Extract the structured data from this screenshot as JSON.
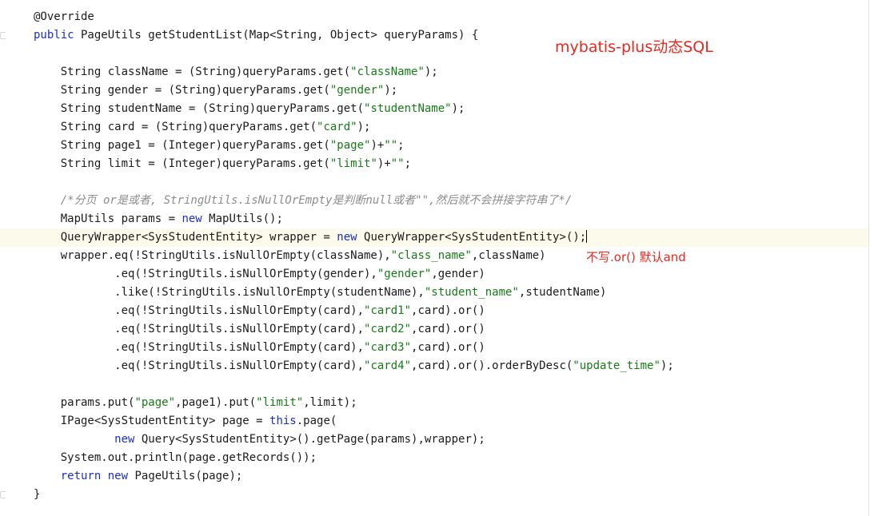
{
  "editor": {
    "lines": [
      [
        {
          "t": "@Override",
          "c": "plain"
        }
      ],
      [
        {
          "t": "public",
          "c": "kw"
        },
        {
          "t": " PageUtils getStudentList(Map<String, Object> queryParams) {",
          "c": "plain"
        }
      ],
      [],
      [
        {
          "t": "    String className = (String)queryParams.get(",
          "c": "plain"
        },
        {
          "t": "\"className\"",
          "c": "str"
        },
        {
          "t": ");",
          "c": "plain"
        }
      ],
      [
        {
          "t": "    String gender = (String)queryParams.get(",
          "c": "plain"
        },
        {
          "t": "\"gender\"",
          "c": "str"
        },
        {
          "t": ");",
          "c": "plain"
        }
      ],
      [
        {
          "t": "    String studentName = (String)queryParams.get(",
          "c": "plain"
        },
        {
          "t": "\"studentName\"",
          "c": "str"
        },
        {
          "t": ");",
          "c": "plain"
        }
      ],
      [
        {
          "t": "    String card = (String)queryParams.get(",
          "c": "plain"
        },
        {
          "t": "\"card\"",
          "c": "str"
        },
        {
          "t": ");",
          "c": "plain"
        }
      ],
      [
        {
          "t": "    String page1 = (Integer)queryParams.get(",
          "c": "plain"
        },
        {
          "t": "\"page\"",
          "c": "str"
        },
        {
          "t": ")+",
          "c": "plain"
        },
        {
          "t": "\"\"",
          "c": "str"
        },
        {
          "t": ";",
          "c": "plain"
        }
      ],
      [
        {
          "t": "    String limit = (Integer)queryParams.get(",
          "c": "plain"
        },
        {
          "t": "\"limit\"",
          "c": "str"
        },
        {
          "t": ")+",
          "c": "plain"
        },
        {
          "t": "\"\"",
          "c": "str"
        },
        {
          "t": ";",
          "c": "plain"
        }
      ],
      [],
      [
        {
          "t": "    /*分页 or是或者, StringUtils.isNullOrEmpty是判断null或者\"\",然后就不会拼接字符串了*/",
          "c": "cmt"
        }
      ],
      [
        {
          "t": "    MapUtils params = ",
          "c": "plain"
        },
        {
          "t": "new",
          "c": "kw"
        },
        {
          "t": " MapUtils();",
          "c": "plain"
        }
      ],
      [
        {
          "t": "    QueryWrapper<SysStudentEntity> wrapper = ",
          "c": "plain"
        },
        {
          "t": "new",
          "c": "kw"
        },
        {
          "t": " QueryWrapper<SysStudentEntity>();",
          "c": "plain"
        }
      ],
      [
        {
          "t": "    wrapper.eq(!StringUtils.isNullOrEmpty(className),",
          "c": "plain"
        },
        {
          "t": "\"class_name\"",
          "c": "str"
        },
        {
          "t": ",className)",
          "c": "plain"
        }
      ],
      [
        {
          "t": "            .eq(!StringUtils.isNullOrEmpty(gender),",
          "c": "plain"
        },
        {
          "t": "\"gender\"",
          "c": "str"
        },
        {
          "t": ",gender)",
          "c": "plain"
        }
      ],
      [
        {
          "t": "            .like(!StringUtils.isNullOrEmpty(studentName),",
          "c": "plain"
        },
        {
          "t": "\"student_name\"",
          "c": "str"
        },
        {
          "t": ",studentName)",
          "c": "plain"
        }
      ],
      [
        {
          "t": "            .eq(!StringUtils.isNullOrEmpty(card),",
          "c": "plain"
        },
        {
          "t": "\"card1\"",
          "c": "str"
        },
        {
          "t": ",card).or()",
          "c": "plain"
        }
      ],
      [
        {
          "t": "            .eq(!StringUtils.isNullOrEmpty(card),",
          "c": "plain"
        },
        {
          "t": "\"card2\"",
          "c": "str"
        },
        {
          "t": ",card).or()",
          "c": "plain"
        }
      ],
      [
        {
          "t": "            .eq(!StringUtils.isNullOrEmpty(card),",
          "c": "plain"
        },
        {
          "t": "\"card3\"",
          "c": "str"
        },
        {
          "t": ",card).or()",
          "c": "plain"
        }
      ],
      [
        {
          "t": "            .eq(!StringUtils.isNullOrEmpty(card),",
          "c": "plain"
        },
        {
          "t": "\"card4\"",
          "c": "str"
        },
        {
          "t": ",card).or().orderByDesc(",
          "c": "plain"
        },
        {
          "t": "\"update_time\"",
          "c": "str"
        },
        {
          "t": ");",
          "c": "plain"
        }
      ],
      [],
      [
        {
          "t": "    params.put(",
          "c": "plain"
        },
        {
          "t": "\"page\"",
          "c": "str"
        },
        {
          "t": ",page1).put(",
          "c": "plain"
        },
        {
          "t": "\"limit\"",
          "c": "str"
        },
        {
          "t": ",limit);",
          "c": "plain"
        }
      ],
      [
        {
          "t": "    IPage<SysStudentEntity> page = ",
          "c": "plain"
        },
        {
          "t": "this",
          "c": "kw"
        },
        {
          "t": ".page(",
          "c": "plain"
        }
      ],
      [
        {
          "t": "            ",
          "c": "plain"
        },
        {
          "t": "new",
          "c": "kw"
        },
        {
          "t": " Query<SysStudentEntity>().getPage(params),wrapper);",
          "c": "plain"
        }
      ],
      [
        {
          "t": "    System.out.println(page.getRecords());",
          "c": "plain"
        }
      ],
      [
        {
          "t": "    ",
          "c": "plain"
        },
        {
          "t": "return",
          "c": "kw"
        },
        {
          "t": " ",
          "c": "plain"
        },
        {
          "t": "new",
          "c": "kw"
        },
        {
          "t": " PageUtils(page);",
          "c": "plain"
        }
      ],
      [
        {
          "t": "}",
          "c": "plain"
        }
      ]
    ],
    "current_line": 12
  },
  "annotations": {
    "title": "mybatis-plus动态SQL",
    "or_note": "不写.or() 默认and"
  },
  "colors": {
    "keyword": "#1a2ec8",
    "string": "#177a17",
    "comment": "#8c8c8c",
    "annotation_text": "#e8281e",
    "current_line_bg": "#fcfbeb"
  }
}
